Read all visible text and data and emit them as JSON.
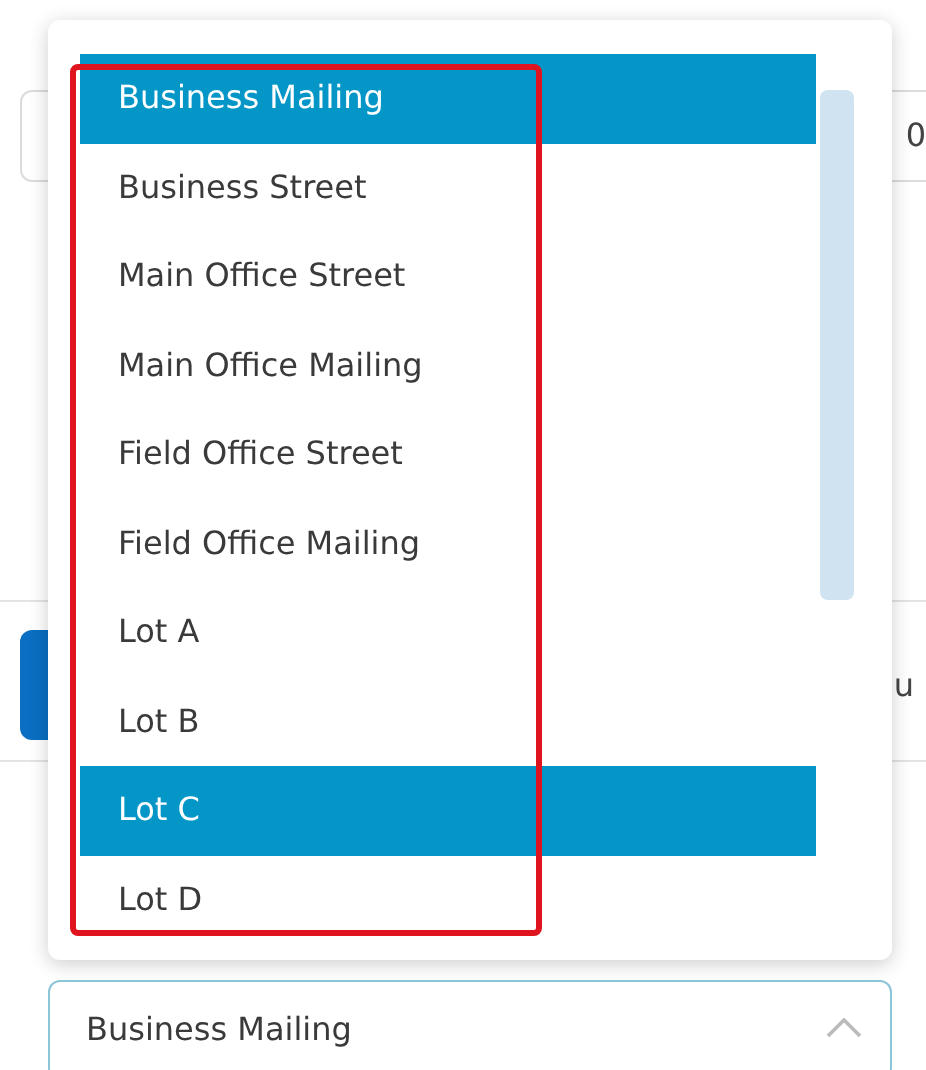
{
  "background": {
    "field_value": "0",
    "row_text": "u"
  },
  "dropdown": {
    "options": [
      {
        "label": "Business Mailing",
        "selected": true
      },
      {
        "label": "Business Street",
        "selected": false
      },
      {
        "label": "Main Office Street",
        "selected": false
      },
      {
        "label": "Main Office Mailing",
        "selected": false
      },
      {
        "label": "Field Office Street",
        "selected": false
      },
      {
        "label": "Field Office Mailing",
        "selected": false
      },
      {
        "label": "Lot A",
        "selected": false
      },
      {
        "label": "Lot B",
        "selected": false
      },
      {
        "label": "Lot C",
        "selected": true
      },
      {
        "label": "Lot D",
        "selected": false
      }
    ]
  },
  "select": {
    "value": "Business Mailing",
    "expanded": true
  },
  "annotation": {
    "shown": true
  }
}
